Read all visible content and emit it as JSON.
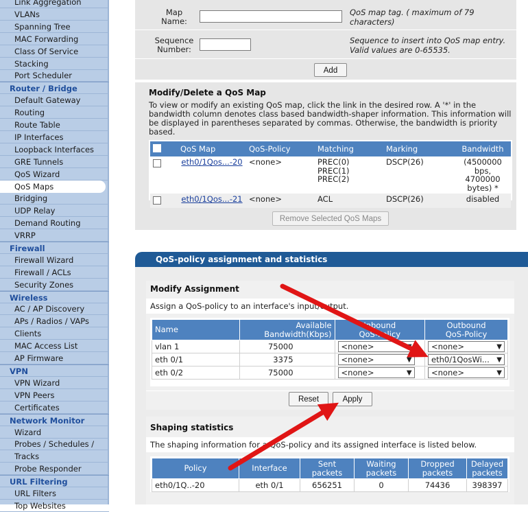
{
  "sidebar": {
    "rows": [
      {
        "label": "Link Aggregation",
        "type": "item"
      },
      {
        "label": "VLANs",
        "type": "item"
      },
      {
        "label": "Spanning Tree",
        "type": "item"
      },
      {
        "label": "MAC Forwarding",
        "type": "item"
      },
      {
        "label": "Class Of Service",
        "type": "item"
      },
      {
        "label": "Stacking",
        "type": "item"
      },
      {
        "label": "Port Scheduler",
        "type": "item"
      },
      {
        "label": "Router / Bridge",
        "type": "header"
      },
      {
        "label": "Default Gateway",
        "type": "item"
      },
      {
        "label": "Routing",
        "type": "item"
      },
      {
        "label": "Route Table",
        "type": "item"
      },
      {
        "label": "IP Interfaces",
        "type": "item"
      },
      {
        "label": "Loopback Interfaces",
        "type": "item"
      },
      {
        "label": "GRE Tunnels",
        "type": "item"
      },
      {
        "label": "QoS Wizard",
        "type": "item"
      },
      {
        "label": "QoS Maps",
        "type": "item",
        "active": true
      },
      {
        "label": "Bridging",
        "type": "item"
      },
      {
        "label": "UDP Relay",
        "type": "item"
      },
      {
        "label": "Demand Routing",
        "type": "item"
      },
      {
        "label": "VRRP",
        "type": "item"
      },
      {
        "label": "Firewall",
        "type": "header"
      },
      {
        "label": "Firewall Wizard",
        "type": "item"
      },
      {
        "label": "Firewall / ACLs",
        "type": "item"
      },
      {
        "label": "Security Zones",
        "type": "item"
      },
      {
        "label": "Wireless",
        "type": "header"
      },
      {
        "label": "AC / AP Discovery",
        "type": "item"
      },
      {
        "label": "APs / Radios / VAPs",
        "type": "item"
      },
      {
        "label": "Clients",
        "type": "item"
      },
      {
        "label": "MAC Access List",
        "type": "item"
      },
      {
        "label": "AP Firmware",
        "type": "item"
      },
      {
        "label": "VPN",
        "type": "header"
      },
      {
        "label": "VPN Wizard",
        "type": "item"
      },
      {
        "label": "VPN Peers",
        "type": "item"
      },
      {
        "label": "Certificates",
        "type": "item"
      },
      {
        "label": "Network Monitor",
        "type": "header"
      },
      {
        "label": "Wizard",
        "type": "item"
      },
      {
        "label": "Probes / Schedules /",
        "type": "item"
      },
      {
        "label": "Tracks",
        "type": "item"
      },
      {
        "label": "Probe Responder",
        "type": "item"
      },
      {
        "label": "URL Filtering",
        "type": "header"
      },
      {
        "label": "URL Filters",
        "type": "item"
      },
      {
        "label": "Top Websites",
        "type": "item"
      }
    ]
  },
  "create": {
    "map_name_label": "Map\nName:",
    "map_name_value": "",
    "map_name_help": "QoS map tag. ( maximum of 79 characters)",
    "seq_label": "Sequence\nNumber:",
    "seq_value": "",
    "seq_help": "Sequence to insert into QoS map entry. Valid values are 0-65535.",
    "add_label": "Add"
  },
  "modify_delete": {
    "title": "Modify/Delete a QoS Map",
    "description": "To view or modify an existing QoS map, click the link in the desired row. A '*' in the bandwidth column denotes class based bandwidth-shaper information. This information will be displayed in parentheses separated by commas. Otherwise, the bandwidth is priority based.",
    "columns": [
      "QoS Map",
      "QoS-Policy",
      "Matching",
      "Marking",
      "Bandwidth"
    ],
    "rows": [
      {
        "map": "eth0/1Qos...-20",
        "policy": "<none>",
        "matching": "PREC(0)\nPREC(1)\nPREC(2)",
        "marking": "DSCP(26)",
        "bandwidth": "(4500000 bps,\n4700000\nbytes) *"
      },
      {
        "map": "eth0/1Qos...-21",
        "policy": "<none>",
        "matching": "ACL",
        "marking": "DSCP(26)",
        "bandwidth": "disabled"
      }
    ],
    "remove_label": "Remove Selected QoS Maps"
  },
  "assignment": {
    "tab_title": "QoS-policy assignment and statistics",
    "modify_title": "Modify Assignment",
    "modify_desc": "Assign a QoS-policy to an interface's input/output.",
    "columns": {
      "name": "Name",
      "avail": "Available\nBandwidth(Kbps)",
      "inbound": "Inbound\nQoS-Policy",
      "outbound": "Outbound\nQoS-Policy"
    },
    "rows": [
      {
        "name": "vlan 1",
        "avail": "75000",
        "inbound": "<none>",
        "outbound": "<none>"
      },
      {
        "name": "eth 0/1",
        "avail": "3375",
        "inbound": "<none>",
        "outbound": "eth0/1QosWi..."
      },
      {
        "name": "eth 0/2",
        "avail": "75000",
        "inbound": "<none>",
        "outbound": "<none>"
      }
    ],
    "reset_label": "Reset",
    "apply_label": "Apply"
  },
  "shaping": {
    "title": "Shaping statistics",
    "desc": "The shaping information for a QoS-policy and its assigned interface is listed below.",
    "columns": [
      "Policy",
      "Interface",
      "Sent\npackets",
      "Waiting\npackets",
      "Dropped\npackets",
      "Delayed\npackets"
    ],
    "rows": [
      {
        "policy": "eth0/1Q..-20",
        "interface": "eth 0/1",
        "sent": "656251",
        "waiting": "0",
        "dropped": "74436",
        "delayed": "398397"
      }
    ]
  },
  "annotations": {
    "arrow_color": "#e01515"
  }
}
